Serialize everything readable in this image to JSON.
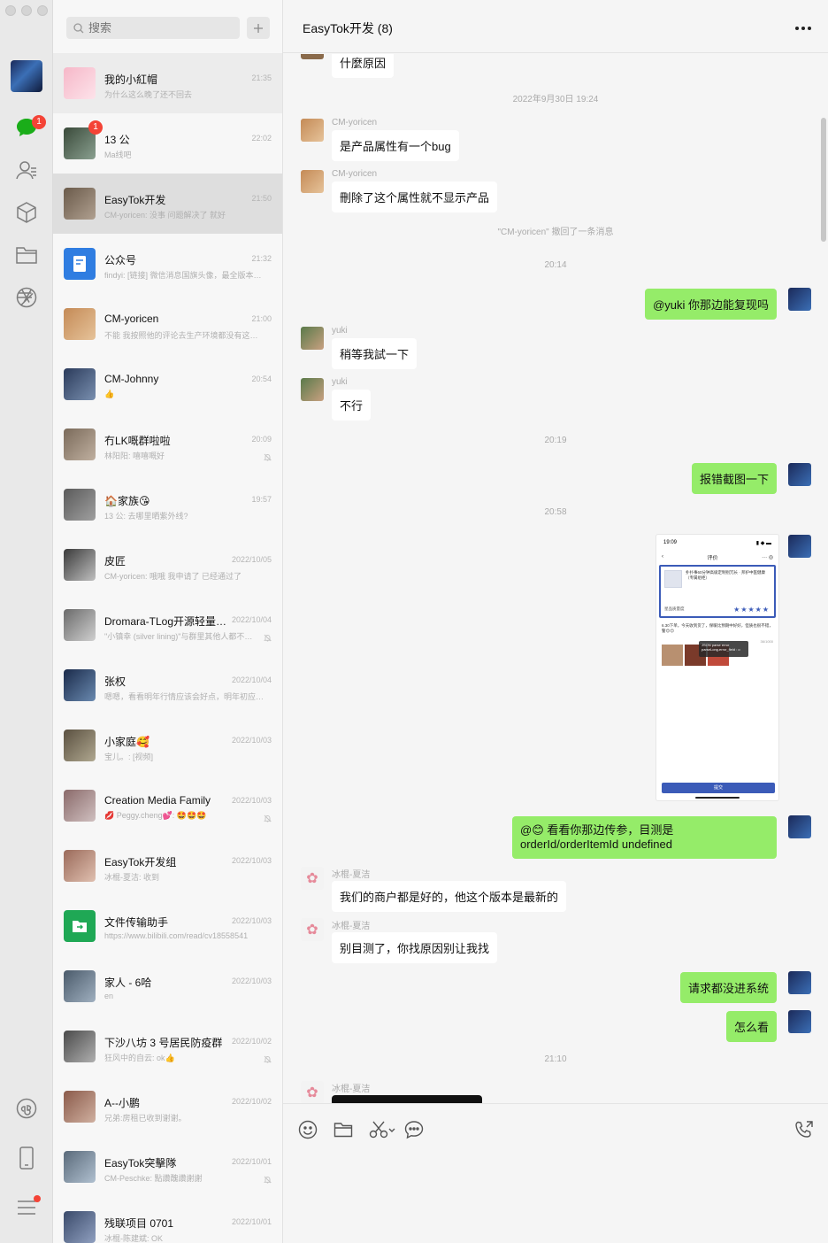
{
  "window": {
    "title": "EasyTok开发 (8)"
  },
  "rail": {
    "chat_badge": "1"
  },
  "search": {
    "placeholder": "搜索"
  },
  "conversations": [
    {
      "name": "我的小紅帽",
      "time": "21:35",
      "preview": "为什么这么晚了还不回去",
      "badge": "",
      "muted": false
    },
    {
      "name": "13 公",
      "time": "22:02",
      "preview": "Ma线吧",
      "badge": "1",
      "muted": false
    },
    {
      "name": "EasyTok开发",
      "time": "21:50",
      "preview": "CM-yoricen: 没事  问题解决了 就好",
      "badge": "",
      "muted": false
    },
    {
      "name": "公众号",
      "time": "21:32",
      "preview": "findyi: [链接] 微信消息国旗头像，最全版本…",
      "badge": "",
      "muted": false
    },
    {
      "name": "CM-yoricen",
      "time": "21:00",
      "preview": "不能  我按照他的评论去生产环境都没有这…",
      "badge": "",
      "muted": false
    },
    {
      "name": "CM-Johnny",
      "time": "20:54",
      "preview": "👍",
      "badge": "",
      "muted": false
    },
    {
      "name": "冇LK嘅群啦啦",
      "time": "20:09",
      "preview": "林阳阳: 嘻嘻嘅好",
      "badge": "",
      "muted": true
    },
    {
      "name": "🏠家族😘",
      "time": "19:57",
      "preview": "13 公: 去哪里晒紫外线?",
      "badge": "",
      "muted": false
    },
    {
      "name": "皮匠",
      "time": "2022/10/05",
      "preview": "CM-yoricen: 哦哦  我申请了 已经通过了",
      "badge": "",
      "muted": false
    },
    {
      "name": "Dromara-TLog开源轻量…",
      "time": "2022/10/04",
      "preview": "\"小镇幸 (silver lining)\"与群里其他人都不…",
      "badge": "",
      "muted": true
    },
    {
      "name": "张权",
      "time": "2022/10/04",
      "preview": "嗯嗯，看看明年行情应该会好点，明年初应…",
      "badge": "",
      "muted": false
    },
    {
      "name": "小家庭🥰",
      "time": "2022/10/03",
      "preview": "宝儿。: [视频]",
      "badge": "",
      "muted": false
    },
    {
      "name": "Creation Media Family",
      "time": "2022/10/03",
      "preview": "💋 Peggy.cheng💕: 🤩🤩🤩",
      "badge": "",
      "muted": true
    },
    {
      "name": "EasyTok开发组",
      "time": "2022/10/03",
      "preview": "冰棍-夏洁: 收到",
      "badge": "",
      "muted": false
    },
    {
      "name": "文件传输助手",
      "time": "2022/10/03",
      "preview": "https://www.bilibili.com/read/cv18558541",
      "badge": "",
      "muted": false
    },
    {
      "name": "家人 - 6哈",
      "time": "2022/10/03",
      "preview": "en",
      "badge": "",
      "muted": false
    },
    {
      "name": "下沙八坊 3 号居民防疫群",
      "time": "2022/10/02",
      "preview": "狂风中的自云: ok👍",
      "badge": "",
      "muted": true
    },
    {
      "name": "A--小鹏",
      "time": "2022/10/02",
      "preview": "兄弟:房租已收到谢谢。",
      "badge": "",
      "muted": false
    },
    {
      "name": "EasyTok突擊隊",
      "time": "2022/10/01",
      "preview": "CM-Peschke: 點讚醜讚謝謝",
      "badge": "",
      "muted": true
    },
    {
      "name": "残联项目 0701",
      "time": "2022/10/01",
      "preview": "冰棍-陈建斌: OK",
      "badge": "",
      "muted": false
    }
  ],
  "messages": {
    "top_partial": "什麼原因",
    "ts1": "2022年9月30日 19:24",
    "m1_sender": "CM-yoricen",
    "m1_text": "是产品属性有一个bug",
    "m2_sender": "CM-yoricen",
    "m2_text": "刪除了这个属性就不显示产品",
    "recall_notice": "\"CM-yoricen\" 撤回了一条消息",
    "ts2": "20:14",
    "m3_text": "@yuki 你那边能复现吗",
    "m4_sender": "yuki",
    "m4_text": "稍等我試一下",
    "m5_sender": "yuki",
    "m5_text": "不行",
    "ts3": "20:19",
    "m6_text": "报错截图一下",
    "ts4": "20:58",
    "m7_text": "@😊 看看你那边传参，目测是 orderId/orderItemId undefined",
    "m8_sender": "冰棍-夏洁",
    "m8_text": "我们的商户都是好的，他这个版本是最新的",
    "m9_sender": "冰棍-夏洁",
    "m9_text": "别目测了，你找原因别让我找",
    "m10_text": "请求都没进系统",
    "m11_text": "怎么看",
    "ts5": "21:10",
    "m12_sender": "冰棍-夏洁"
  },
  "screenshot": {
    "time": "19:09",
    "title": "评价",
    "product": "扑扑事60分钟高级定制别冗长 · 邦护中医健康（专属组柜）",
    "stars_label": "星品质量度",
    "comment": "6.30下单，今天收到货了，保暖比预期中好好，但质也很不错，警😊😊",
    "error": "JSON parse error parseLong.error_field : o",
    "count": "36/1000",
    "submit": "提交"
  },
  "colors": {
    "out_bubble": "#95ec69",
    "badge": "#f44336",
    "accent": "#07c160"
  }
}
